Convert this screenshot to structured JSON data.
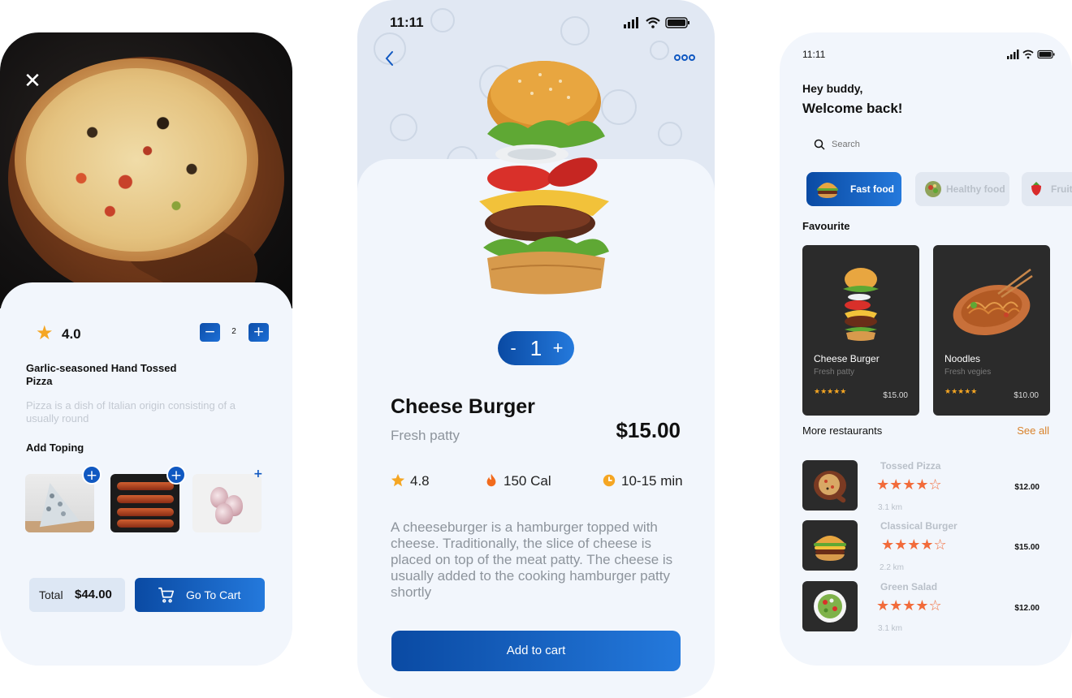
{
  "pizza_screen": {
    "rating": "4.0",
    "quantity": "2",
    "title": "Garlic-seasoned Hand Tossed Pizza",
    "description": "Pizza is a dish of Italian origin consisting of a usually round",
    "add_topping_heading": "Add Toping",
    "toppings": [
      {
        "icon": "blue-cheese"
      },
      {
        "icon": "grilled-sausages"
      },
      {
        "icon": "garlic"
      }
    ],
    "total_label": "Total",
    "total_value": "$44.00",
    "go_to_cart_label": "Go To Cart"
  },
  "burger_screen": {
    "status_time": "11:11",
    "quantity_minus": "-",
    "quantity": "1",
    "quantity_plus": "+",
    "name": "Cheese Burger",
    "subtitle": "Fresh patty",
    "price": "$15.00",
    "rating": "4.8",
    "calories": "150 Cal",
    "time": "10-15 min",
    "description": "A cheeseburger is a hamburger topped with cheese. Traditionally, the slice of cheese is placed on top of the meat patty. The cheese is usually added to the cooking hamburger patty shortly",
    "add_to_cart_label": "Add to cart"
  },
  "home_screen": {
    "status_time": "11:11",
    "greeting": "Hey buddy,",
    "welcome": "Welcome back!",
    "search_placeholder": "Search",
    "categories": [
      {
        "label": "Fast food",
        "icon": "burger"
      },
      {
        "label": "Healthy food",
        "icon": "salad"
      },
      {
        "label": "Fruit",
        "icon": "strawberry"
      }
    ],
    "favourite_heading": "Favourite",
    "favourites": [
      {
        "name": "Cheese Burger",
        "subtitle": "Fresh patty",
        "stars": "★★★★★",
        "rating": 5,
        "price": "$15.00"
      },
      {
        "name": "Noodles",
        "subtitle": "Fresh vegies",
        "stars": "★★★★★",
        "rating": 5,
        "price": "$10.00"
      }
    ],
    "more_restaurants_label": "More restaurants",
    "see_all_label": "See all",
    "restaurants": [
      {
        "name": "Tossed Pizza",
        "stars": "★★★★☆",
        "rating": 4,
        "price": "$12.00",
        "distance": "3.1 km"
      },
      {
        "name": "Classical Burger",
        "stars": "★★★★☆",
        "rating": 4,
        "price": "$15.00",
        "distance": "2.2 km"
      },
      {
        "name": "Green Salad",
        "stars": "★★★★☆",
        "rating": 4,
        "price": "$12.00",
        "distance": "3.1 km"
      }
    ]
  },
  "colors": {
    "accent_blue": "#1058c1",
    "star_orange": "#f5a623",
    "see_all_orange": "#d9822b",
    "card_dark": "#2b2b2b",
    "background": "#f2f6fc"
  }
}
